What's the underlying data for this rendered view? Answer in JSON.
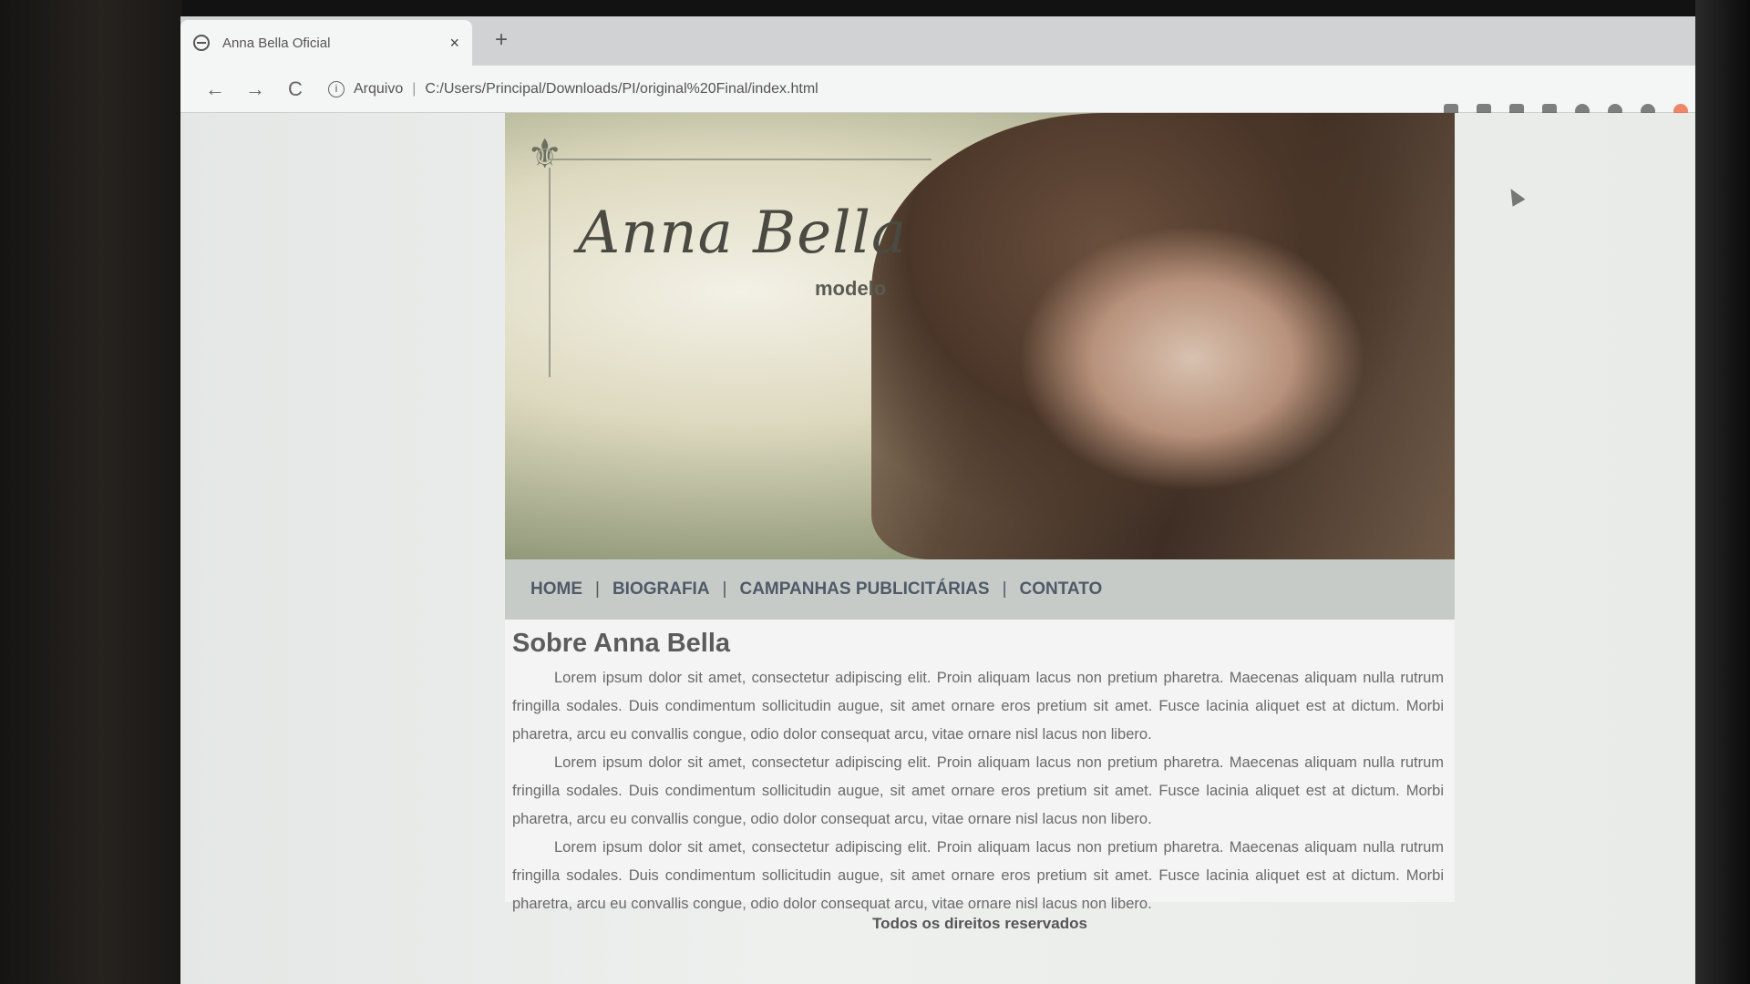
{
  "browser": {
    "tab_title": "Anna Bella Oficial",
    "tab_close": "×",
    "new_tab": "+",
    "back": "←",
    "forward": "→",
    "reload": "C",
    "info_glyph": "i",
    "scheme_label": "Arquivo",
    "separator": "|",
    "url": "C:/Users/Principal/Downloads/PI/original%20Final/index.html"
  },
  "site": {
    "fleur": "⚜",
    "brand": "Anna Bella",
    "brand_sub": "modelo",
    "nav": {
      "home": "HOME",
      "biografia": "BIOGRAFIA",
      "campanhas": "CAMPANHAS PUBLICITÁRIAS",
      "contato": "CONTATO",
      "pipe": "|"
    },
    "heading": "Sobre Anna Bella",
    "paragraphs": [
      "Lorem ipsum dolor sit amet, consectetur adipiscing elit. Proin aliquam lacus non pretium pharetra. Maecenas aliquam nulla rutrum fringilla sodales. Duis condimentum sollicitudin augue, sit amet ornare eros pretium sit amet. Fusce lacinia aliquet est at dictum. Morbi pharetra, arcu eu convallis congue, odio dolor consequat arcu, vitae ornare nisl lacus non libero.",
      "Lorem ipsum dolor sit amet, consectetur adipiscing elit. Proin aliquam lacus non pretium pharetra. Maecenas aliquam nulla rutrum fringilla sodales. Duis condimentum sollicitudin augue, sit amet ornare eros pretium sit amet. Fusce lacinia aliquet est at dictum. Morbi pharetra, arcu eu convallis congue, odio dolor consequat arcu, vitae ornare nisl lacus non libero.",
      "Lorem ipsum dolor sit amet, consectetur adipiscing elit. Proin aliquam lacus non pretium pharetra. Maecenas aliquam nulla rutrum fringilla sodales. Duis condimentum sollicitudin augue, sit amet ornare eros pretium sit amet. Fusce lacinia aliquet est at dictum. Morbi pharetra, arcu eu convallis congue, odio dolor consequat arcu, vitae ornare nisl lacus non libero."
    ],
    "footer": "Todos os direitos reservados"
  },
  "colors": {
    "nav_text": "#4f5a68",
    "menu_bg": "#c7cbc8",
    "content_bg": "#f3f4f3"
  },
  "icons": [
    "globe-icon",
    "info-icon",
    "translate-icon",
    "star-icon",
    "extension-icon",
    "profile-icon",
    "opera-icon"
  ]
}
